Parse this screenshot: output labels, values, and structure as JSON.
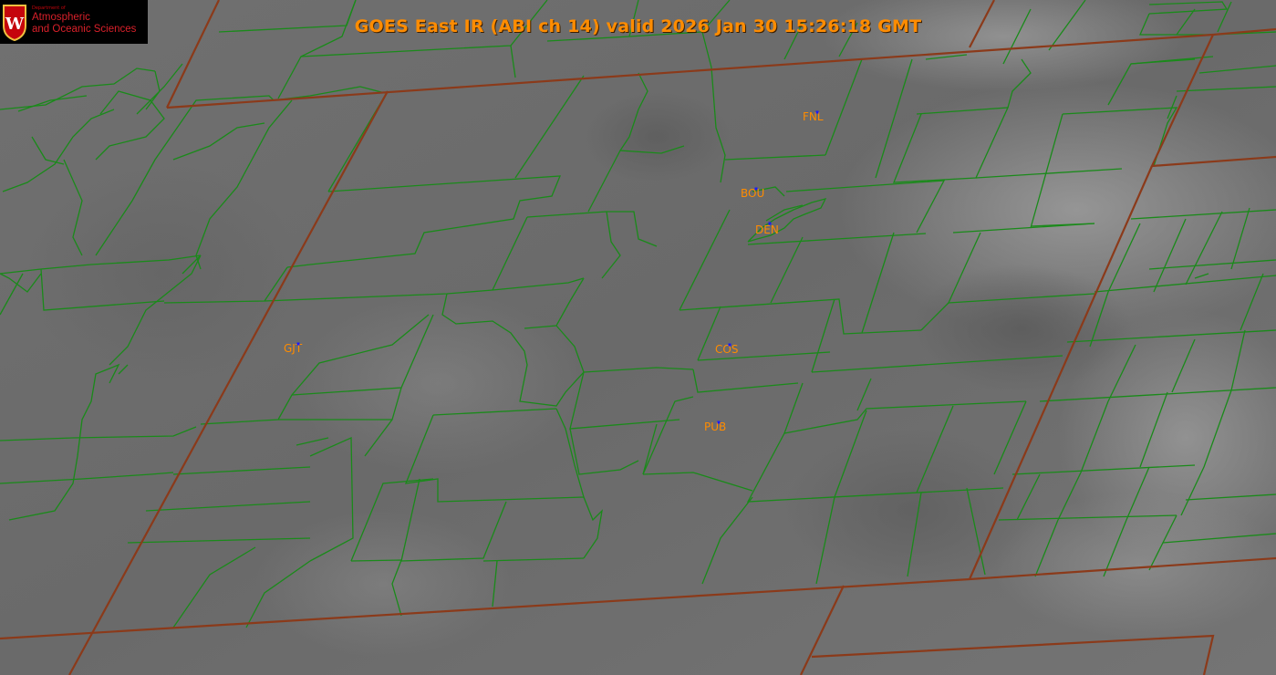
{
  "title": "GOES East IR (ABI ch 14) valid 2026 Jan 30 15:26:18 GMT",
  "logo": {
    "department": "Department of",
    "line1": "Atmospheric",
    "line2": "and Oceanic Sciences",
    "emblem": "W"
  },
  "colors": {
    "county_lines": "#1a8a1a",
    "state_lines": "#8b3a1a",
    "labels": "#ff8c00",
    "station_dots": "#1a1aff",
    "background_gray": "#6e6e6e"
  },
  "stations": [
    {
      "id": "FNL"
    },
    {
      "id": "BOU"
    },
    {
      "id": "DEN"
    },
    {
      "id": "GJT"
    },
    {
      "id": "COS"
    },
    {
      "id": "PUB"
    }
  ]
}
